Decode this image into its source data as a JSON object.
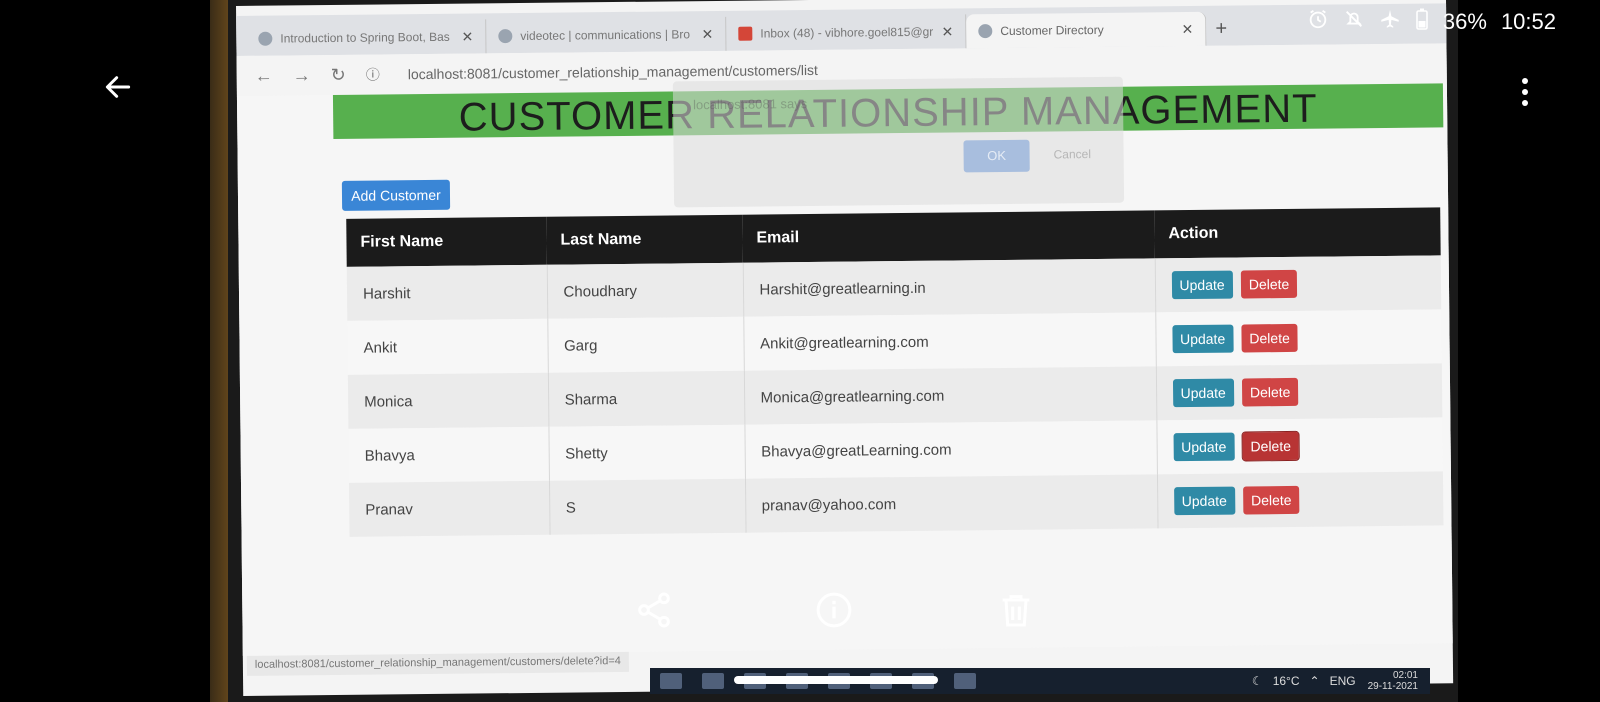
{
  "status_bar": {
    "battery": "36%",
    "time": "10:52"
  },
  "browser": {
    "tabs": [
      {
        "label": "Introduction to Spring Boot, Bas"
      },
      {
        "label": "videotec | communications | Bro"
      },
      {
        "label": "Inbox (48) - vibhore.goel815@gr"
      },
      {
        "label": "Customer Directory"
      }
    ],
    "url": "localhost:8081/customer_relationship_management/customers/list",
    "status_url": "localhost:8081/customer_relationship_management/customers/delete?id=4"
  },
  "page": {
    "title": "CUSTOMER RELATIONSHIP MANAGEMENT",
    "add_button": "Add Customer",
    "dialog": {
      "text": "localhost:8081 says",
      "ok": "OK",
      "cancel": "Cancel"
    },
    "table": {
      "headers": [
        "First Name",
        "Last Name",
        "Email",
        "Action"
      ],
      "rows": [
        {
          "first": "Harshit",
          "last": "Choudhary",
          "email": "Harshit@greatlearning.in",
          "update": "Update",
          "delete": "Delete"
        },
        {
          "first": "Ankit",
          "last": "Garg",
          "email": "Ankit@greatlearning.com",
          "update": "Update",
          "delete": "Delete"
        },
        {
          "first": "Monica",
          "last": "Sharma",
          "email": "Monica@greatlearning.com",
          "update": "Update",
          "delete": "Delete"
        },
        {
          "first": "Bhavya",
          "last": "Shetty",
          "email": "Bhavya@greatLearning.com",
          "update": "Update",
          "delete": "Delete"
        },
        {
          "first": "Pranav",
          "last": "S",
          "email": "pranav@yahoo.com",
          "update": "Update",
          "delete": "Delete"
        }
      ]
    }
  },
  "taskbar": {
    "temperature": "16°C",
    "lang": "ENG",
    "time": "02:01",
    "date": "29-11-2021"
  },
  "icons": {
    "back": "back-arrow-icon",
    "more": "more-vert-icon",
    "share": "share-icon",
    "info": "info-icon",
    "delete": "trash-icon"
  },
  "colors": {
    "header_band": "#57b04e",
    "update_button": "#2f8aa6",
    "delete_button": "#d04545",
    "add_button": "#3a86d6",
    "table_header": "#1b1b1b"
  }
}
